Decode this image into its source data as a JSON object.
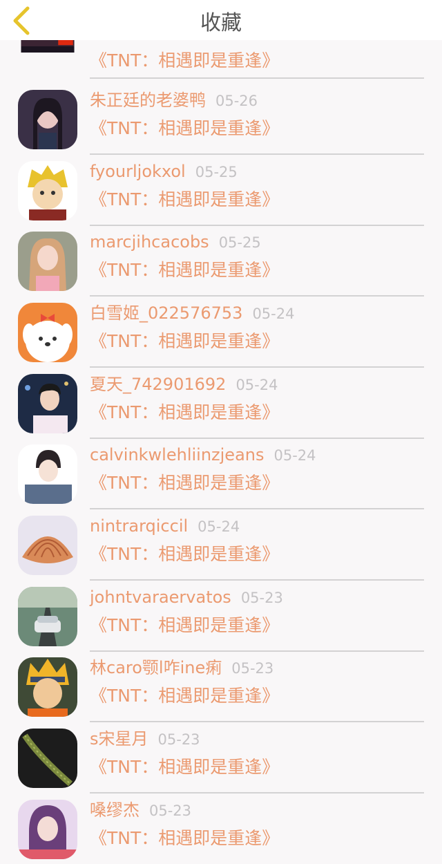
{
  "header": {
    "title": "收藏",
    "back_icon": "chevron-left-icon",
    "back_icon_color": "#e6c42c"
  },
  "colors": {
    "accent": "#eb9a70",
    "date": "#c4c2c4",
    "divider": "#d3d2d3",
    "background": "#f9f7f8"
  },
  "favorites": [
    {
      "username": "",
      "date": "",
      "work_title": "《TNT：相遇即是重逢》",
      "avatar": "night-city-flag-avatar"
    },
    {
      "username": "朱正廷的老婆鸭",
      "date": "05-26",
      "work_title": "《TNT：相遇即是重逢》",
      "avatar": "girl-portrait-avatar"
    },
    {
      "username": "fyourljokxol",
      "date": "05-25",
      "work_title": "《TNT：相遇即是重逢》",
      "avatar": "anime-blond-boy-avatar"
    },
    {
      "username": "marcjihcacobs",
      "date": "05-25",
      "work_title": "《TNT：相遇即是重逢》",
      "avatar": "pink-girl-avatar"
    },
    {
      "username": "白雪姬_022576753",
      "date": "05-24",
      "work_title": "《TNT：相遇即是重逢》",
      "avatar": "cartoon-dog-avatar"
    },
    {
      "username": "夏天_742901692",
      "date": "05-24",
      "work_title": "《TNT：相遇即是重逢》",
      "avatar": "boy-night-avatar"
    },
    {
      "username": "calvinkwlehliinzjeans",
      "date": "05-24",
      "work_title": "《TNT：相遇即是重逢》",
      "avatar": "anime-boy-denim-avatar"
    },
    {
      "username": "nintrarqiccil",
      "date": "05-24",
      "work_title": "《TNT：相遇即是重逢》",
      "avatar": "seashell-avatar"
    },
    {
      "username": "johntvaraervatos",
      "date": "05-23",
      "work_title": "《TNT：相遇即是重逢》",
      "avatar": "race-car-avatar"
    },
    {
      "username": "林caro颚l咋ine痢",
      "date": "05-23",
      "work_title": "《TNT：相遇即是重逢》",
      "avatar": "naruto-avatar"
    },
    {
      "username": "s宋星月",
      "date": "05-23",
      "work_title": "《TNT：相遇即是重逢》",
      "avatar": "dark-leaf-avatar"
    },
    {
      "username": "嗓缪杰",
      "date": "05-23",
      "work_title": "《TNT：相遇即是重逢》",
      "avatar": "purple-hair-girl-avatar"
    }
  ]
}
